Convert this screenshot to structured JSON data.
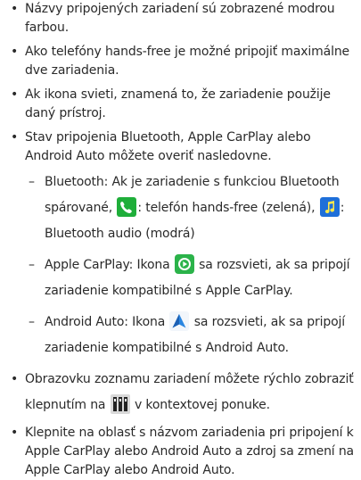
{
  "bullets": [
    {
      "text": "Názvy pripojených zariadení sú zobrazené modrou farbou."
    },
    {
      "text": "Ako telefóny hands-free je možné pripojiť maximálne dve zariadenia."
    },
    {
      "text": "Ak ikona svieti, znamená to, že zariadenie použije daný prístroj."
    },
    {
      "text": "Stav pripojenia Bluetooth, Apple CarPlay alebo Android Auto môžete overiť nasledovne."
    }
  ],
  "sub": {
    "bluetooth_a": "Bluetooth: Ak je zariadenie s funkciou Bluetooth spárované,",
    "bluetooth_b": ": telefón hands-free (zelená),",
    "bluetooth_c": ": Bluetooth audio (modrá)",
    "carplay_a": "Apple CarPlay: Ikona",
    "carplay_b": "sa rozsvieti, ak sa pripojí zariadenie kompatibilné s Apple CarPlay.",
    "android_a": "Android Auto: Ikona",
    "android_b": "sa rozsvieti, ak sa pripojí zariadenie kompatibilné s Android Auto."
  },
  "list_bullet": {
    "a": "Obrazovku zoznamu zariadení môžete rýchlo zobraziť klepnutím na",
    "b": "v kontextovej ponuke."
  },
  "last_bullet": "Klepnite na oblasť s názvom zariadenia pri pripojení k Apple CarPlay alebo Android Auto a zdroj sa zmení na Apple CarPlay alebo Android Auto.",
  "icons": {
    "phone": "phone-handsfree-icon",
    "music": "bluetooth-audio-icon",
    "carplay": "apple-carplay-icon",
    "android": "android-auto-icon",
    "devlist": "device-list-icon"
  },
  "colors": {
    "phone_green": "#1fae3a",
    "audio_blue": "#1e6fd9",
    "carplay_green": "#2bb34a",
    "android_blue": "#2a86e0"
  }
}
